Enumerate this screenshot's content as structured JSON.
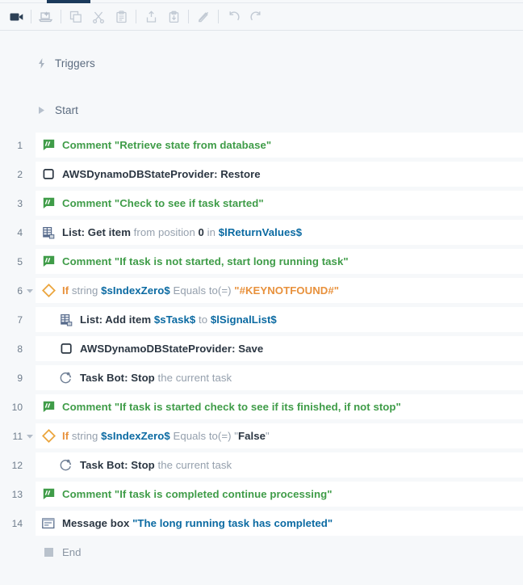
{
  "toolbar": {
    "buttons": [
      {
        "name": "record-icon",
        "title": "Record"
      },
      {
        "name": "screen-capture-icon",
        "title": "Screen capture"
      },
      {
        "name": "copy-icon",
        "title": "Copy"
      },
      {
        "name": "cut-icon",
        "title": "Cut"
      },
      {
        "name": "paste-icon",
        "title": "Paste"
      },
      {
        "name": "export-icon",
        "title": "Export"
      },
      {
        "name": "import-icon",
        "title": "Import"
      },
      {
        "name": "disable-icon",
        "title": "Disable action"
      },
      {
        "name": "undo-icon",
        "title": "Undo"
      },
      {
        "name": "redo-icon",
        "title": "Redo"
      }
    ]
  },
  "sections": {
    "triggers_label": "Triggers",
    "start_label": "Start",
    "end_label": "End"
  },
  "colors": {
    "accent_tab": "#1b3a5c",
    "comment_green": "#3f9c48",
    "if_orange": "#e8913c",
    "variable_blue": "#0b6aa2",
    "row_bg": "#ffffff",
    "canvas_bg": "#f6f8fa"
  },
  "steps": [
    {
      "number": "1",
      "icon": "comment-icon",
      "indent": 0,
      "twisty": "",
      "parts": [
        {
          "t": "Comment",
          "s": "green"
        },
        {
          "t": " ",
          "s": "plain"
        },
        {
          "t": "\"Retrieve state from database\"",
          "s": "green-q"
        }
      ]
    },
    {
      "number": "2",
      "icon": "package-icon",
      "indent": 0,
      "twisty": "",
      "parts": [
        {
          "t": "AWSDynamoDBStateProvider: Restore",
          "s": "b"
        }
      ]
    },
    {
      "number": "3",
      "icon": "comment-icon",
      "indent": 0,
      "twisty": "",
      "parts": [
        {
          "t": "Comment",
          "s": "green"
        },
        {
          "t": " ",
          "s": "plain"
        },
        {
          "t": "\"Check to see if task started\"",
          "s": "green-q"
        }
      ]
    },
    {
      "number": "4",
      "icon": "list-icon",
      "indent": 0,
      "twisty": "",
      "parts": [
        {
          "t": "List: Get item",
          "s": "b"
        },
        {
          "t": " from position ",
          "s": "dim"
        },
        {
          "t": "0",
          "s": "numlit"
        },
        {
          "t": " in ",
          "s": "dim"
        },
        {
          "t": "$lReturnValues$",
          "s": "var"
        }
      ]
    },
    {
      "number": "5",
      "icon": "comment-icon",
      "indent": 0,
      "twisty": "",
      "parts": [
        {
          "t": "Comment",
          "s": "green"
        },
        {
          "t": " ",
          "s": "plain"
        },
        {
          "t": "\"If task is not started, start long running task\"",
          "s": "green-q"
        }
      ]
    },
    {
      "number": "6",
      "icon": "if-diamond-icon",
      "indent": 0,
      "twisty": "expanded",
      "parts": [
        {
          "t": "If",
          "s": "kw-if"
        },
        {
          "t": " string ",
          "s": "dim"
        },
        {
          "t": "$sIndexZero$",
          "s": "var"
        },
        {
          "t": " Equals to(=) ",
          "s": "dim"
        },
        {
          "t": "\"#KEYNOTFOUND#\"",
          "s": "str-orange"
        }
      ]
    },
    {
      "number": "7",
      "icon": "list-icon",
      "indent": 1,
      "twisty": "",
      "parts": [
        {
          "t": "List: Add item",
          "s": "b"
        },
        {
          "t": " ",
          "s": "plain"
        },
        {
          "t": "$sTask$",
          "s": "var"
        },
        {
          "t": " to ",
          "s": "dim"
        },
        {
          "t": "$lSignalList$",
          "s": "var"
        }
      ]
    },
    {
      "number": "8",
      "icon": "package-icon",
      "indent": 1,
      "twisty": "",
      "parts": [
        {
          "t": "AWSDynamoDBStateProvider: Save",
          "s": "b"
        }
      ]
    },
    {
      "number": "9",
      "icon": "taskbot-icon",
      "indent": 1,
      "twisty": "",
      "parts": [
        {
          "t": "Task Bot: ",
          "s": "plain-dark"
        },
        {
          "t": "Stop",
          "s": "b"
        },
        {
          "t": " the current task",
          "s": "dim"
        }
      ]
    },
    {
      "number": "10",
      "icon": "comment-icon",
      "indent": 0,
      "twisty": "",
      "parts": [
        {
          "t": "Comment",
          "s": "green"
        },
        {
          "t": " ",
          "s": "plain"
        },
        {
          "t": "\"If task is started check to see if its finished, if not stop\"",
          "s": "green-q"
        }
      ]
    },
    {
      "number": "11",
      "icon": "if-diamond-icon",
      "indent": 0,
      "twisty": "expanded",
      "parts": [
        {
          "t": "If",
          "s": "kw-if"
        },
        {
          "t": " string ",
          "s": "dim"
        },
        {
          "t": "$sIndexZero$",
          "s": "var"
        },
        {
          "t": " Equals to(=) ",
          "s": "dim"
        },
        {
          "t": "\"",
          "s": "dim"
        },
        {
          "t": "False",
          "s": "b"
        },
        {
          "t": "\"",
          "s": "dim"
        }
      ]
    },
    {
      "number": "12",
      "icon": "taskbot-icon",
      "indent": 1,
      "twisty": "",
      "parts": [
        {
          "t": "Task Bot: ",
          "s": "plain-dark"
        },
        {
          "t": "Stop",
          "s": "b"
        },
        {
          "t": " the current task",
          "s": "dim"
        }
      ]
    },
    {
      "number": "13",
      "icon": "comment-icon",
      "indent": 0,
      "twisty": "",
      "parts": [
        {
          "t": "Comment",
          "s": "green"
        },
        {
          "t": " ",
          "s": "plain"
        },
        {
          "t": "\"If task is completed continue processing\"",
          "s": "green-q"
        }
      ]
    },
    {
      "number": "14",
      "icon": "messagebox-icon",
      "indent": 0,
      "twisty": "",
      "parts": [
        {
          "t": "Message box",
          "s": "b"
        },
        {
          "t": " ",
          "s": "plain"
        },
        {
          "t": "\"The long running task has completed\"",
          "s": "lit"
        }
      ]
    }
  ]
}
